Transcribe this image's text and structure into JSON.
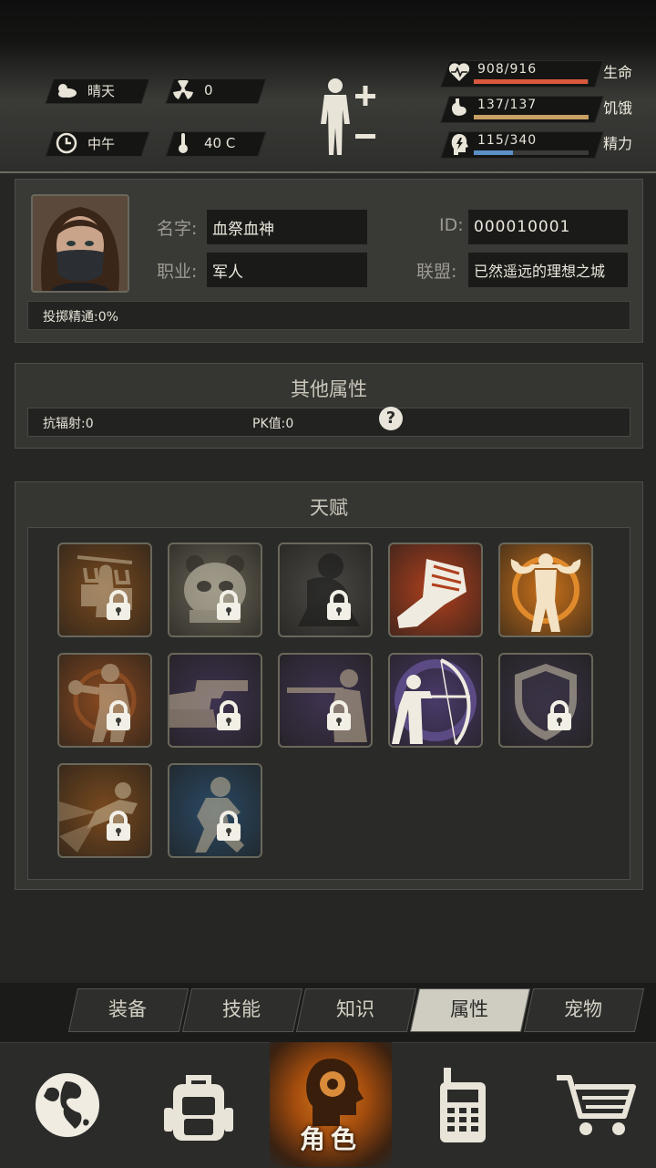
{
  "status": {
    "weather": "晴天",
    "radiation": "0",
    "time_of_day": "中午",
    "temperature": "40 C",
    "stats": [
      {
        "value": "908/916",
        "label": "生命",
        "fill": 0.99,
        "color": "#d9583e",
        "icon": "heart-pulse-icon"
      },
      {
        "value": "137/137",
        "label": "饥饿",
        "fill": 1.0,
        "color": "#c9a063",
        "icon": "stomach-icon"
      },
      {
        "value": "115/340",
        "label": "精力",
        "fill": 0.34,
        "color": "#5b8fc8",
        "icon": "energy-head-icon"
      }
    ]
  },
  "profile": {
    "name_label": "名字:",
    "name_value": "血祭血神",
    "id_label": "ID:",
    "id_value": "000010001",
    "job_label": "职业:",
    "job_value": "军人",
    "alliance_label": "联盟:",
    "alliance_value": "已然遥远的理想之城",
    "throw_mastery": "投掷精通:0%"
  },
  "other_attrs": {
    "title": "其他属性",
    "anti_radiation": "抗辐射:0",
    "pk_value": "PK值:0",
    "help": "?"
  },
  "talents": {
    "title": "天赋",
    "items": [
      {
        "name": "porter-talent",
        "bg": "#7a4a1e",
        "locked": true
      },
      {
        "name": "panda-talent",
        "bg": "#6a6558",
        "locked": true
      },
      {
        "name": "shadow-talent",
        "bg": "#4a4946",
        "locked": true
      },
      {
        "name": "fist-talent",
        "bg": "#b0401e",
        "locked": false
      },
      {
        "name": "strongman-talent",
        "bg": "#c8701a",
        "locked": false
      },
      {
        "name": "boxer-talent",
        "bg": "#8a4a20",
        "locked": true
      },
      {
        "name": "pistol-talent",
        "bg": "#3e3350",
        "locked": true
      },
      {
        "name": "rifle-talent",
        "bg": "#3e3350",
        "locked": true
      },
      {
        "name": "archer-talent",
        "bg": "#4a3a6a",
        "locked": false
      },
      {
        "name": "shield-talent",
        "bg": "#3a3346",
        "locked": true
      },
      {
        "name": "kick-talent",
        "bg": "#7a4a1e",
        "locked": true
      },
      {
        "name": "crouch-talent",
        "bg": "#2a4a66",
        "locked": true
      }
    ]
  },
  "subtabs": [
    "装备",
    "技能",
    "知识",
    "属性",
    "宠物"
  ],
  "active_subtab": "属性",
  "nav": {
    "role_label": "角色",
    "items": [
      "globe-icon",
      "backpack-icon",
      "role-icon",
      "walkie-talkie-icon",
      "cart-icon"
    ]
  }
}
